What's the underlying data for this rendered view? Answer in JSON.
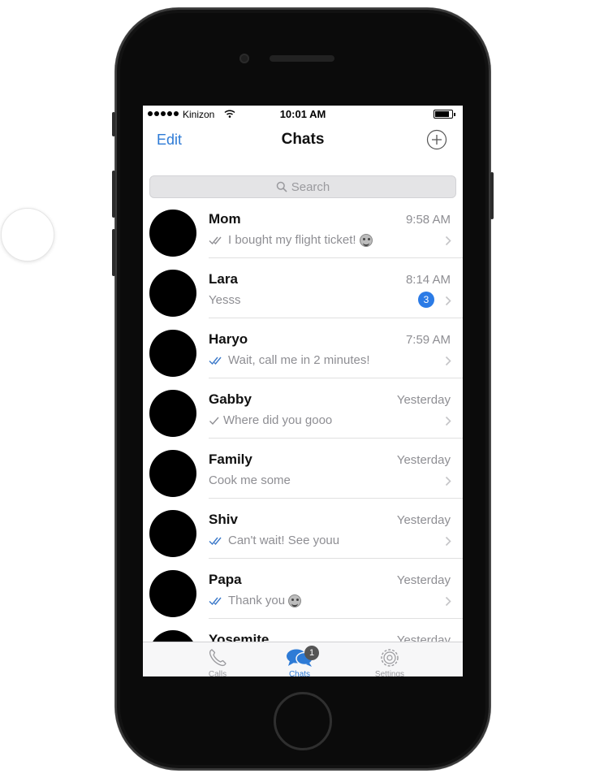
{
  "status_bar": {
    "carrier": "Kinizon",
    "time": "10:01 AM"
  },
  "nav": {
    "edit_label": "Edit",
    "title": "Chats"
  },
  "search": {
    "placeholder": "Search"
  },
  "chats": [
    {
      "name": "Mom",
      "time": "9:58 AM",
      "preview": "I bought my flight ticket!",
      "receipt": "read",
      "emoji": true
    },
    {
      "name": "Lara",
      "time": "8:14 AM",
      "preview": "Yesss",
      "receipt": "none",
      "unread": "3"
    },
    {
      "name": "Haryo",
      "time": "7:59 AM",
      "preview": "Wait, call me in 2 minutes!",
      "receipt": "read"
    },
    {
      "name": "Gabby",
      "time": "Yesterday",
      "preview": "Where did you gooo",
      "receipt": "sent"
    },
    {
      "name": "Family",
      "time": "Yesterday",
      "preview": "Cook me some",
      "receipt": "none"
    },
    {
      "name": "Shiv",
      "time": "Yesterday",
      "preview": "Can't wait! See youu",
      "receipt": "read"
    },
    {
      "name": "Papa",
      "time": "Yesterday",
      "preview": "Thank you",
      "receipt": "read",
      "emoji": true
    },
    {
      "name": "Yosemite",
      "time": "Yesterday",
      "preview": "",
      "receipt": "none"
    }
  ],
  "tabs": {
    "calls": {
      "label": "Calls",
      "icon": "phone-icon"
    },
    "chats": {
      "label": "Chats",
      "icon": "chat-bubbles-icon",
      "badge": "1"
    },
    "settings": {
      "label": "Settings",
      "icon": "gear-icon"
    }
  },
  "colors": {
    "accent": "#2e7bd6",
    "read_tick": "#3a78c9",
    "badge": "#2b7be6"
  }
}
